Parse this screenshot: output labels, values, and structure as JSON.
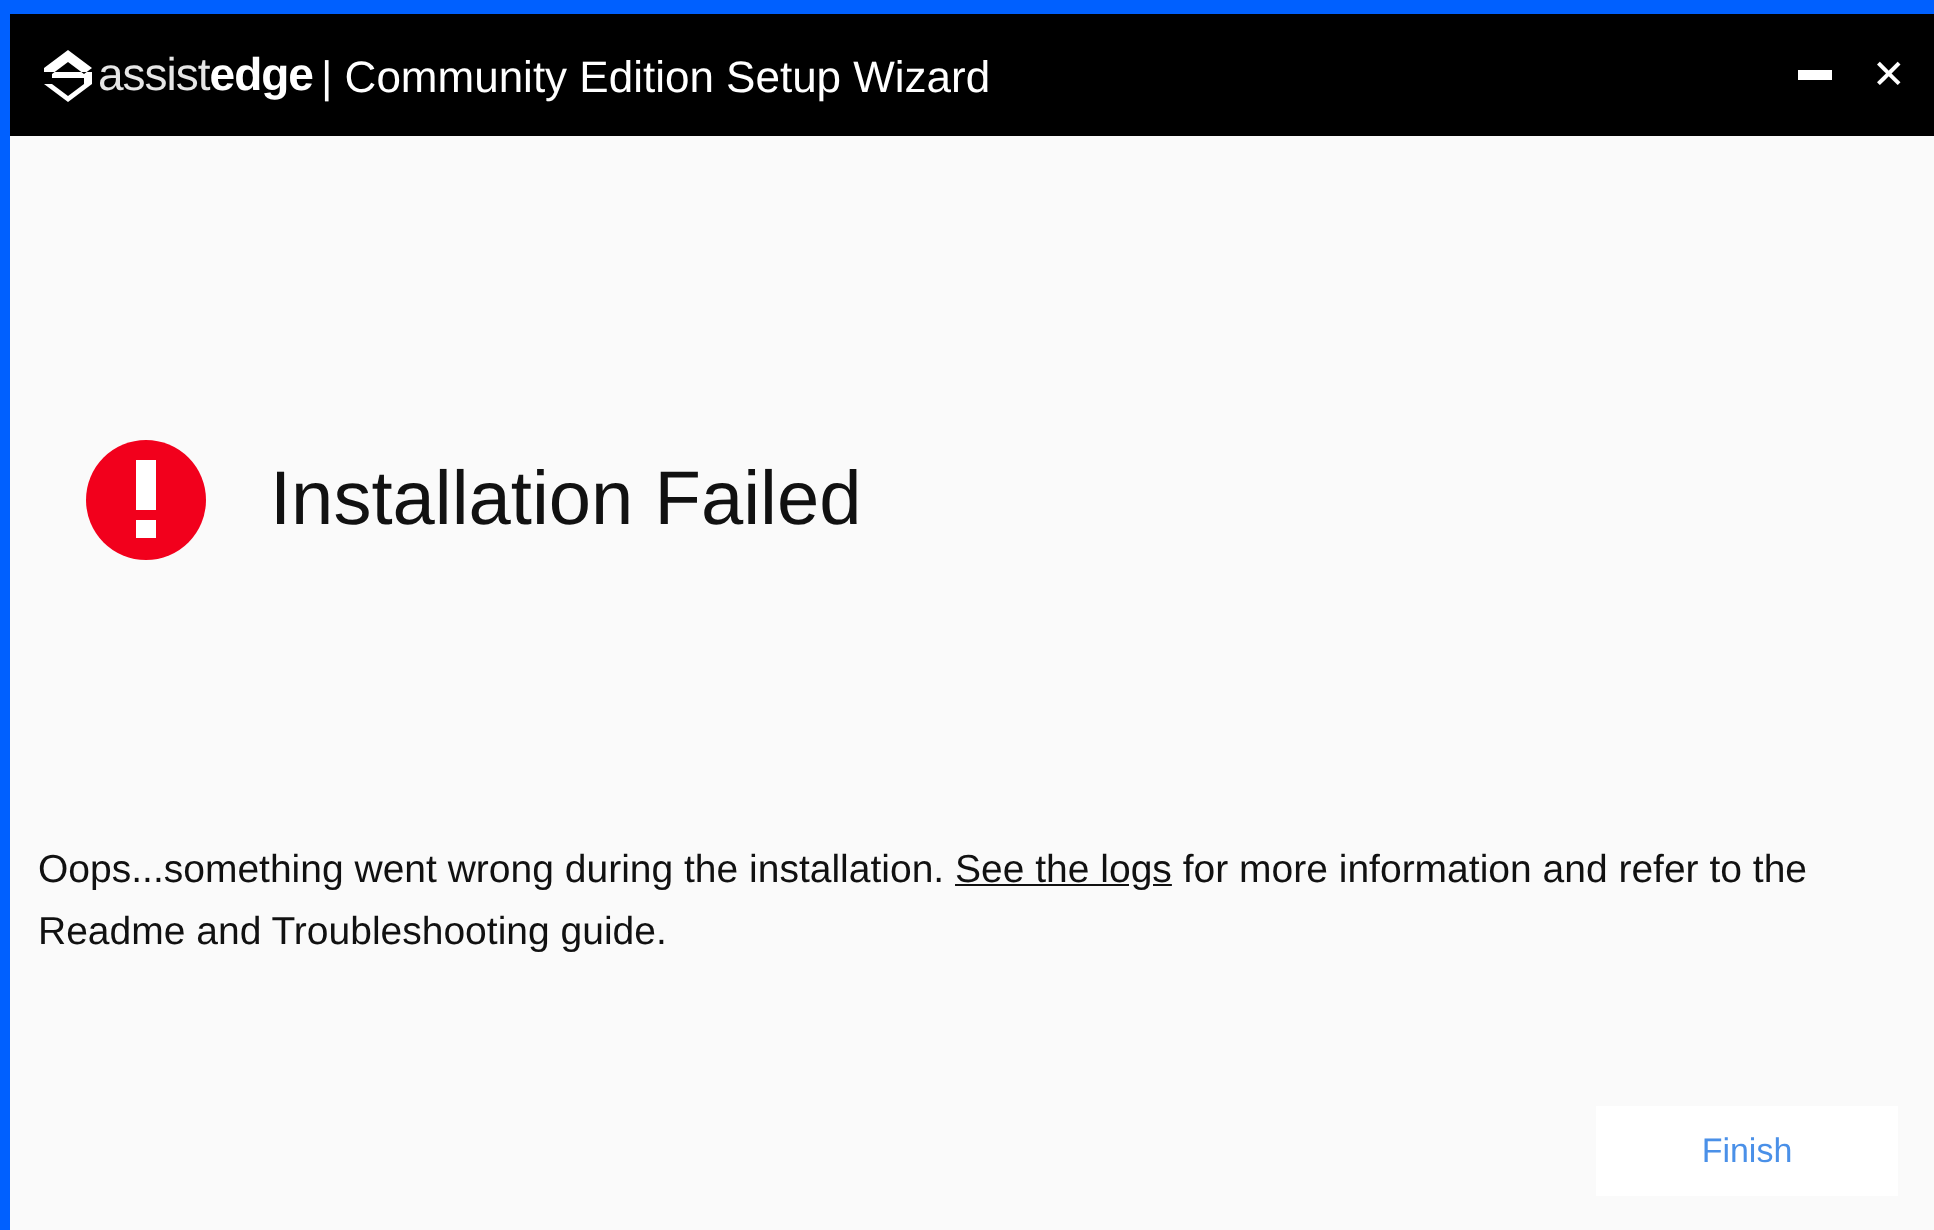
{
  "window": {
    "logo": {
      "light": "assist",
      "bold": "edge"
    },
    "title": "| Community Edition Setup Wizard",
    "controls": [
      {
        "kind": "minimize"
      },
      {
        "kind": "close",
        "label": "✕"
      }
    ]
  },
  "heading": "Installation Failed",
  "message": {
    "before": "Oops...something went wrong during the installation. ",
    "link": "See the logs",
    "after": " for more information and refer to the Readme and Troubleshooting guide."
  },
  "buttons": [
    {
      "label": "Finish"
    }
  ]
}
